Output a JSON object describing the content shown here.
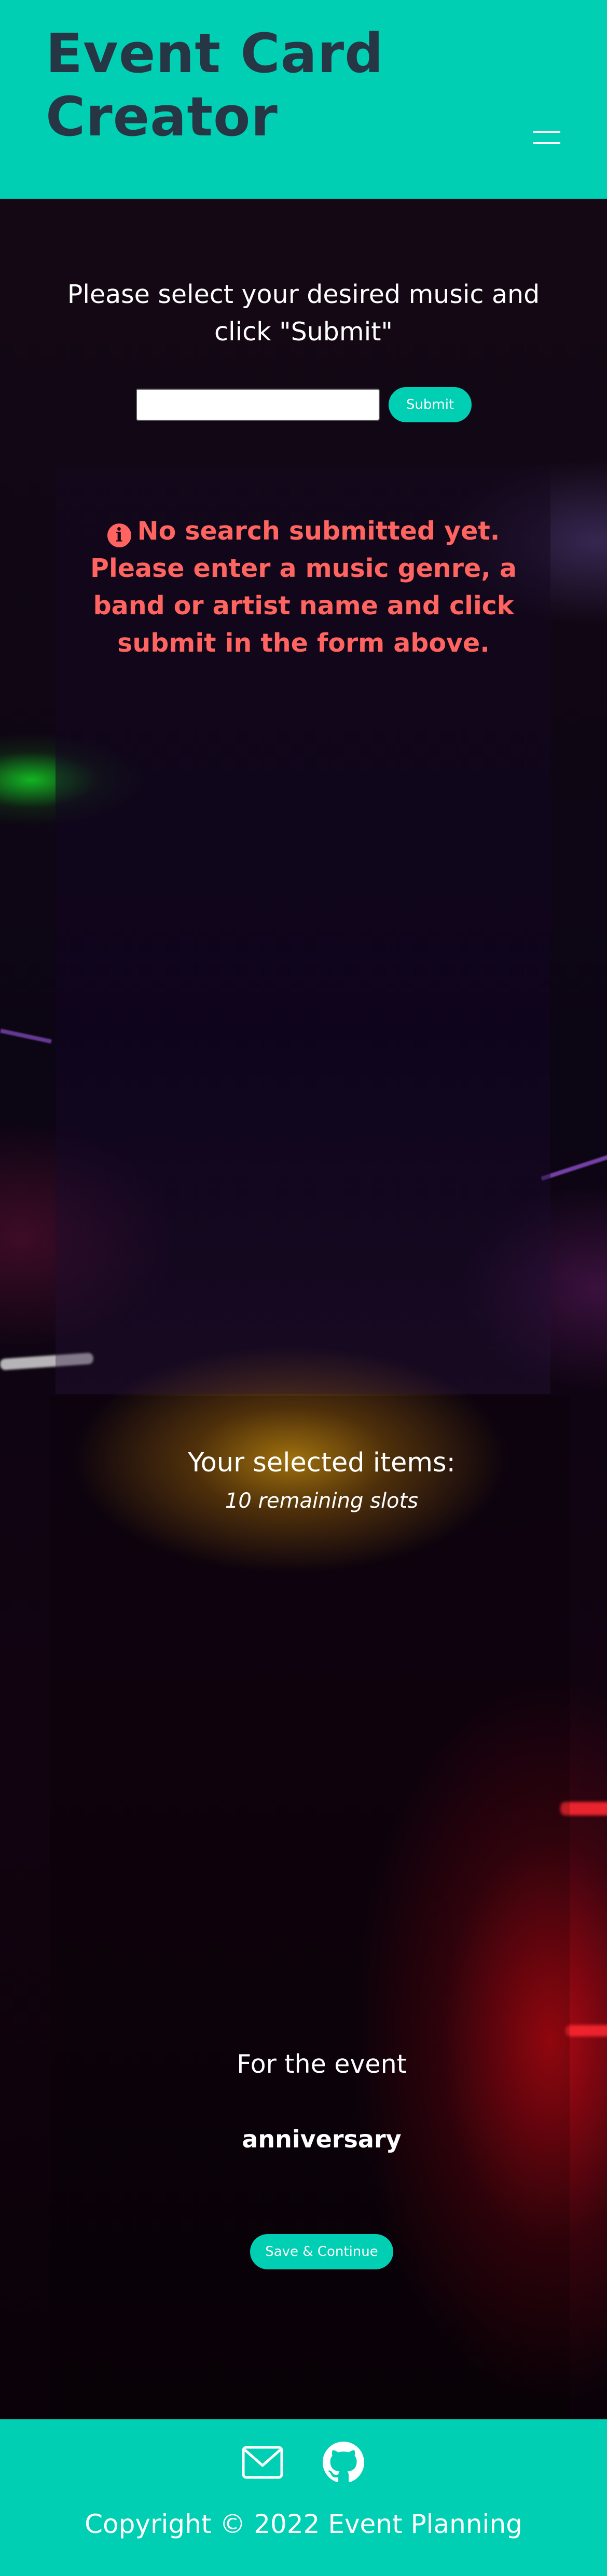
{
  "header": {
    "title": "Event Card Creator",
    "menu_icon": "hamburger-menu-icon"
  },
  "search": {
    "prompt": "Please select your desired music and click \"Submit\"",
    "input_value": "",
    "placeholder": "",
    "submit_label": "Submit"
  },
  "results": {
    "notice_icon": "info-icon",
    "notice_icon_glyph": "i",
    "notice": "No search submitted yet. Please enter a music genre, a band or artist name and click submit in the form above."
  },
  "selection": {
    "title": "Your selected items:",
    "remaining": "10 remaining slots",
    "event_label": "For the event",
    "event_name": "anniversary",
    "save_label": "Save & Continue"
  },
  "footer": {
    "mail_icon": "mail-icon",
    "github_icon": "github-icon",
    "copyright": "Copyright © 2022 Event Planning"
  },
  "colors": {
    "accent": "#00cfb4",
    "title_text": "#263645",
    "error": "#ff6461"
  }
}
